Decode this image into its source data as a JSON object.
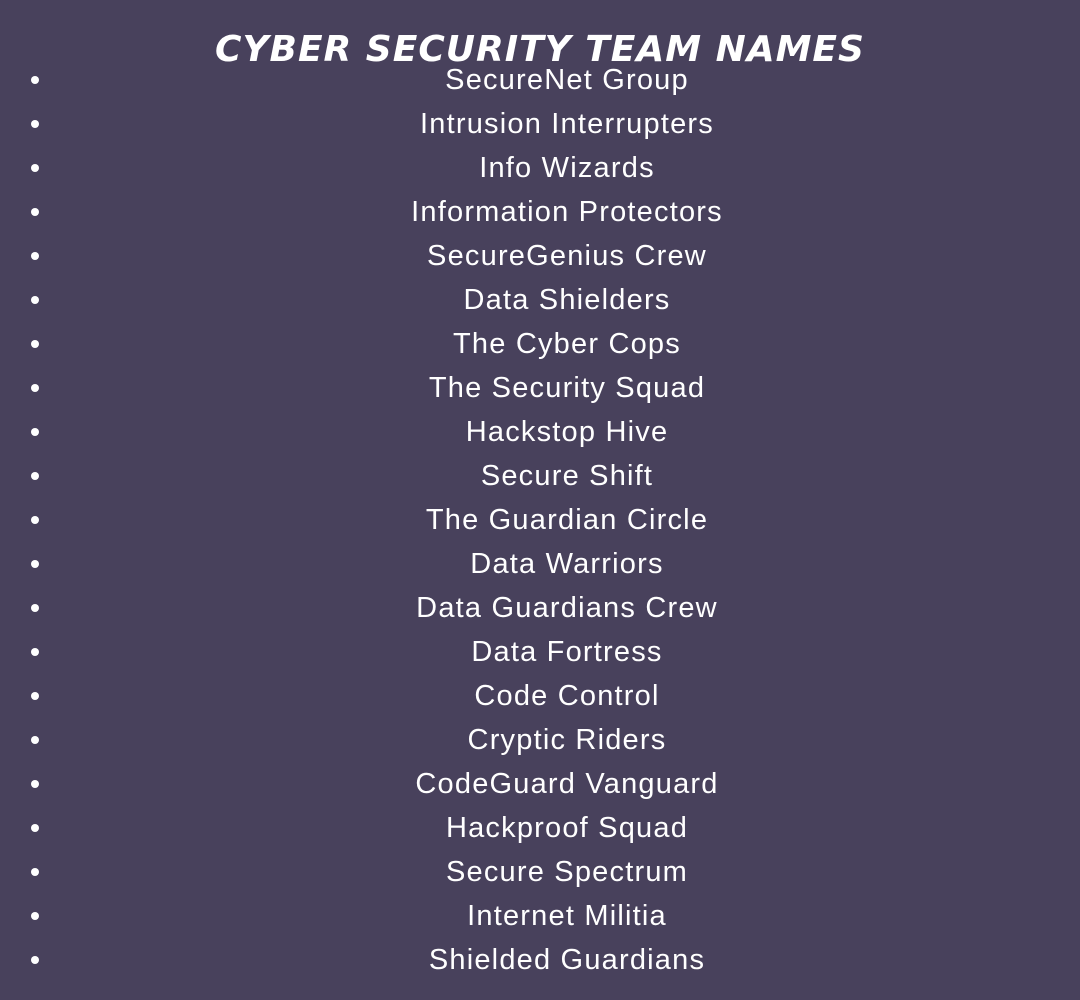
{
  "title": "Cyber Security Team Names",
  "colors": {
    "background": "#48415c",
    "text": "#ffffff"
  },
  "names": [
    "SecureNet Group",
    "Intrusion Interrupters",
    "Info Wizards",
    "Information Protectors",
    "SecureGenius Crew",
    "Data Shielders",
    "The Cyber Cops",
    "The Security Squad",
    "Hackstop Hive",
    "Secure Shift",
    "The Guardian Circle",
    "Data Warriors",
    "Data Guardians Crew",
    "Data Fortress",
    "Code Control",
    "Cryptic Riders",
    "CodeGuard Vanguard",
    "Hackproof Squad",
    "Secure Spectrum",
    "Internet Militia",
    "Shielded Guardians"
  ]
}
